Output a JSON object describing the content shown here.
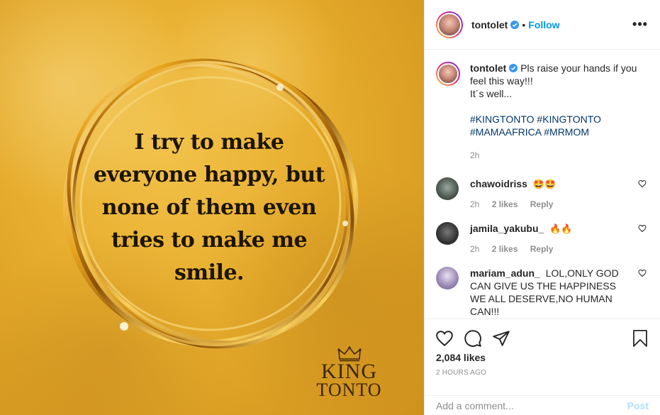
{
  "media": {
    "quote": [
      "I try to make",
      "everyone happy, but",
      "none of them even",
      "tries to make me",
      "smile."
    ],
    "brand_line1": "KING",
    "brand_line2": "TONTO",
    "background_color": "#e6ac2c"
  },
  "header": {
    "username": "tontolet",
    "dot": "•",
    "follow_label": "Follow",
    "more_icon": "more-horizontal-icon",
    "more_label": "•••"
  },
  "caption": {
    "username": "tontolet",
    "text_line1": "Pls raise your hands if you feel this way!!!",
    "text_line2": "It´s well...",
    "hashtags": [
      "#KINGTONTO",
      "#KINGTONTO",
      "#MAMAAFRICA",
      "#MRMOM"
    ],
    "time": "2h"
  },
  "comments": [
    {
      "username": "chawoidriss",
      "text": "🤩🤩",
      "time": "2h",
      "likes": "2 likes",
      "reply": "Reply"
    },
    {
      "username": "jamila_yakubu_",
      "text": "🔥🔥",
      "time": "2h",
      "likes": "2 likes",
      "reply": "Reply"
    },
    {
      "username": "mariam_adun_",
      "text": "LOL,ONLY GOD CAN GIVE US THE HAPPINESS WE ALL DESERVE,NO HUMAN CAN!!!",
      "time": "",
      "likes": "",
      "reply": ""
    }
  ],
  "actions": {
    "likes": "2,084 likes",
    "timestamp": "2 HOURS AGO",
    "comment_placeholder": "Add a comment...",
    "post_label": "Post"
  },
  "colors": {
    "link_blue": "#0095f6",
    "hashtag_blue": "#00376b",
    "verified_blue": "#3897f0",
    "muted": "#8e8e8e",
    "post_disabled": "#b2dffc"
  }
}
